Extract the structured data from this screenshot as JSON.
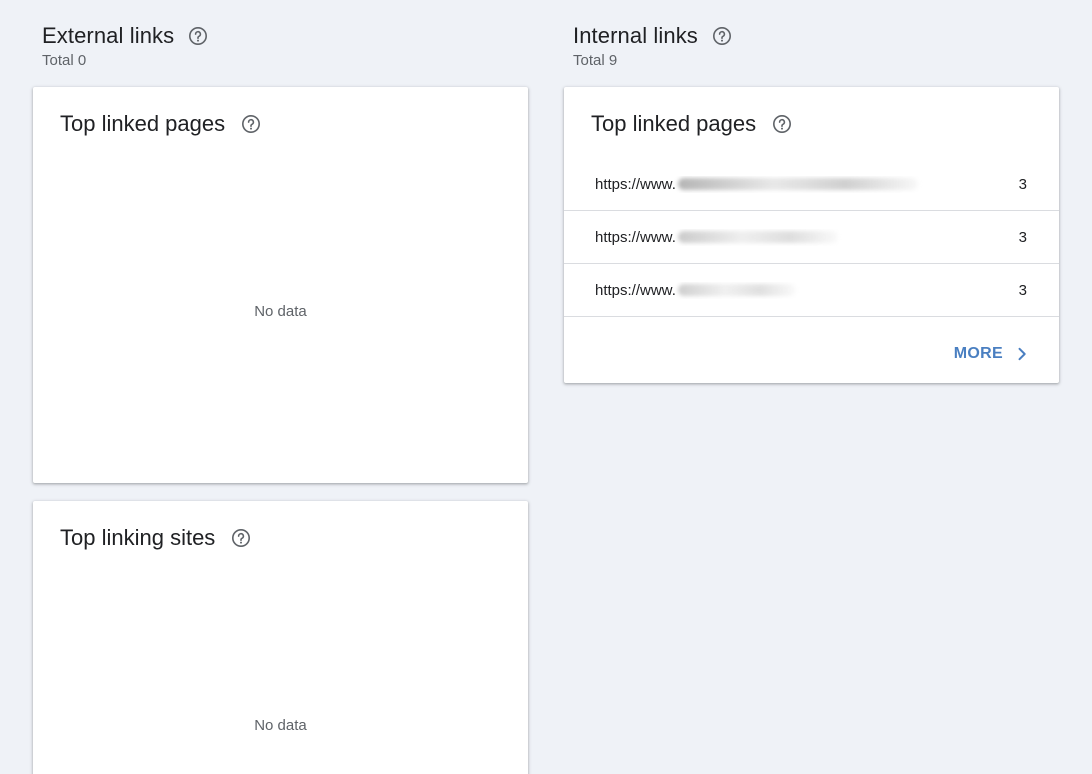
{
  "external": {
    "title": "External links",
    "total": "Total 0",
    "top_linked_pages": {
      "title": "Top linked pages",
      "empty_text": "No data"
    },
    "top_linking_sites": {
      "title": "Top linking sites",
      "empty_text": "No data"
    }
  },
  "internal": {
    "title": "Internal links",
    "total": "Total 9",
    "top_linked_pages": {
      "title": "Top linked pages",
      "rows": [
        {
          "url": "https://www.",
          "count": "3"
        },
        {
          "url": "https://www.",
          "count": "3"
        },
        {
          "url": "https://www.",
          "count": "3"
        }
      ],
      "more_label": "MORE"
    }
  },
  "icons": {
    "help": "help-circle-icon",
    "more": "chevron-right-icon"
  },
  "colors": {
    "background": "#eff2f7",
    "card": "#ffffff",
    "accent": "#4a7fc1",
    "secondary_text": "#5f6368"
  }
}
